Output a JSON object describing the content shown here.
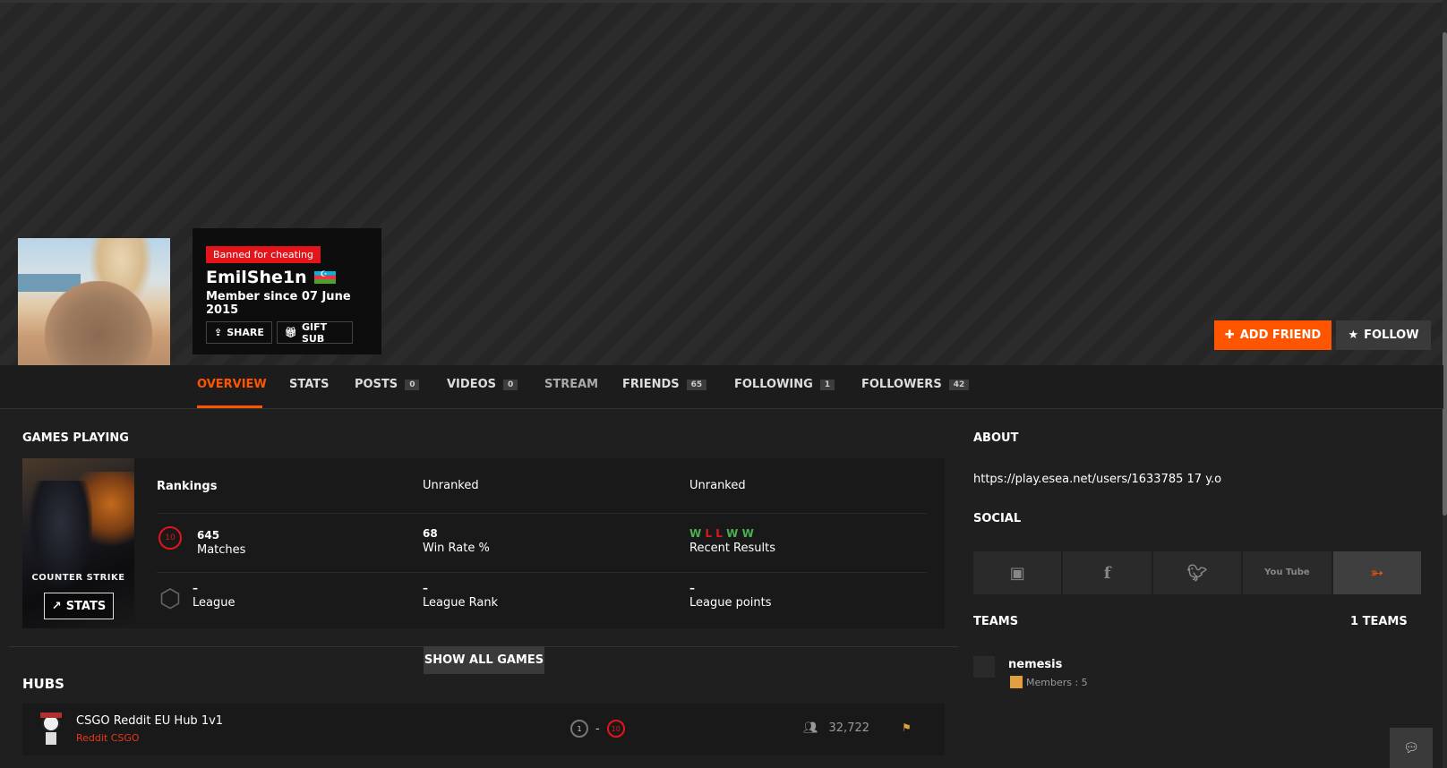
{
  "profile": {
    "ban_badge": "Banned for cheating",
    "username": "EmilShe1n",
    "member_since": "Member since 07 June 2015",
    "share_label": "SHARE",
    "gift_label": "GIFT SUB",
    "add_friend_label": "ADD FRIEND",
    "follow_label": "FOLLOW"
  },
  "nav": {
    "tabs": [
      {
        "label": "OVERVIEW",
        "count": null
      },
      {
        "label": "STATS",
        "count": null
      },
      {
        "label": "POSTS",
        "count": "0"
      },
      {
        "label": "VIDEOS",
        "count": "0"
      },
      {
        "label": "STREAM",
        "count": null
      },
      {
        "label": "FRIENDS",
        "count": "65"
      },
      {
        "label": "FOLLOWING",
        "count": "1"
      },
      {
        "label": "FOLLOWERS",
        "count": "42"
      }
    ]
  },
  "games": {
    "title": "GAMES PLAYING",
    "cover_text": "COUNTER STRIKE",
    "stats_label": "STATS",
    "rankings_label": "Rankings",
    "rank1": "Unranked",
    "rank2": "Unranked",
    "skill_level": "10",
    "matches_value": "645",
    "matches_label": "Matches",
    "winrate_value": "68",
    "winrate_label": "Win Rate %",
    "recent_results": [
      "W",
      "L",
      "L",
      "W",
      "W"
    ],
    "recent_label": "Recent Results",
    "league_value": "–",
    "league_label": "League",
    "league_rank_value": "–",
    "league_rank_label": "League Rank",
    "league_points_value": "–",
    "league_points_label": "League points",
    "show_all_label": "SHOW ALL GAMES"
  },
  "hubs": {
    "title": "HUBS",
    "items": [
      {
        "name": "CSGO Reddit EU Hub 1v1",
        "sub": "Reddit CSGO",
        "min_level": "1",
        "separator": "-",
        "max_level": "10",
        "members": "32,722"
      }
    ]
  },
  "about": {
    "title": "ABOUT",
    "text": "https://play.esea.net/users/1633785 17 y.o"
  },
  "social": {
    "title": "SOCIAL",
    "items": [
      "twitch-icon",
      "facebook-icon",
      "twitter-icon",
      "youtube-icon",
      "steam-icon"
    ],
    "youtube_text": "You Tube"
  },
  "teams": {
    "title": "TEAMS",
    "count_label": "1 TEAMS",
    "items": [
      {
        "name": "nemesis",
        "members": "Members : 5"
      }
    ]
  },
  "colors": {
    "accent": "#ff5500",
    "ban": "#e4141b",
    "win": "#4caf50",
    "loss": "#e4141b"
  }
}
